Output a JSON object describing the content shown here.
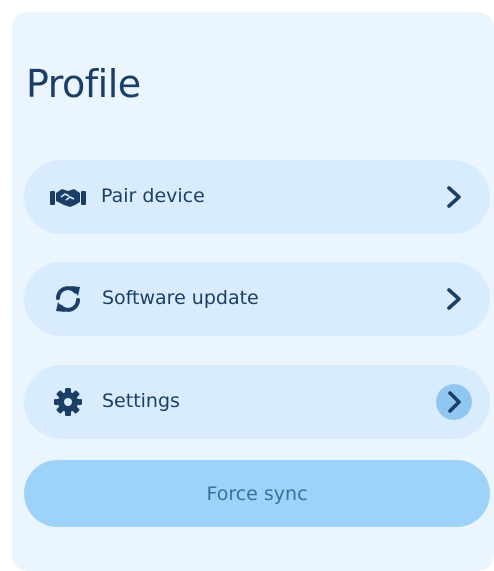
{
  "profile": {
    "title": "Profile"
  },
  "menu": {
    "items": [
      {
        "label": "Pair device",
        "icon": "handshake-icon"
      },
      {
        "label": "Software update",
        "icon": "refresh-icon"
      },
      {
        "label": "Settings",
        "icon": "gear-icon",
        "chevron_highlighted": true
      }
    ]
  },
  "actions": {
    "force_sync_label": "Force sync"
  },
  "colors": {
    "panel_bg": "#eaf5fe",
    "item_bg": "#d8ecfd",
    "text": "#1b3e66",
    "button_bg": "#9dd3f8",
    "button_text": "#3a6f9c"
  }
}
